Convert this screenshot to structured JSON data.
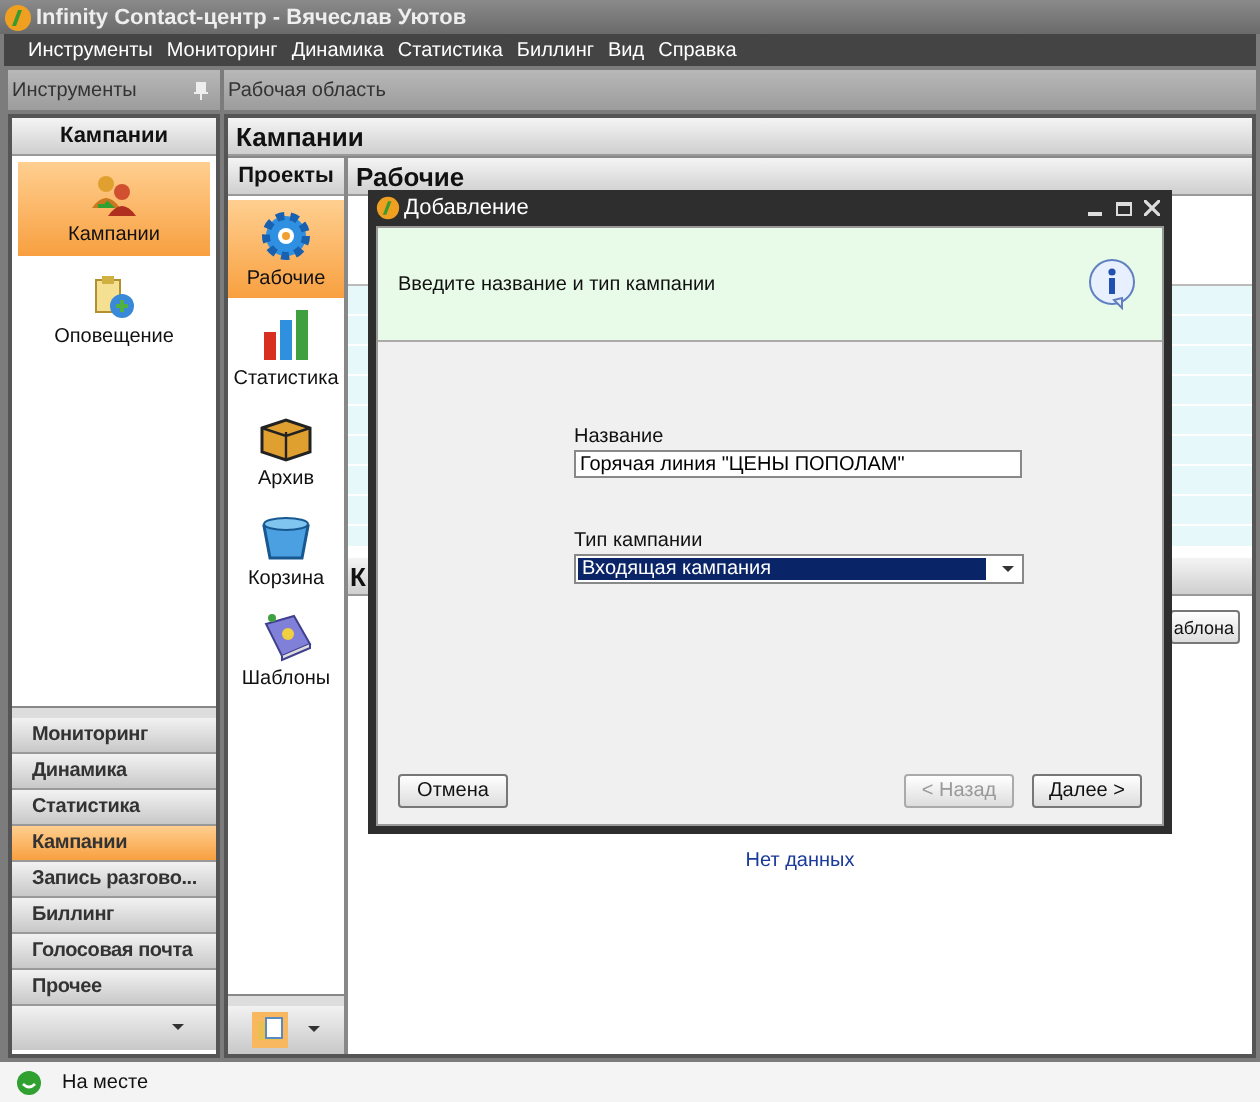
{
  "window": {
    "title": "Infinity Contact-центр - Вячеслав Уютов"
  },
  "menu": [
    "Инструменты",
    "Мониторинг",
    "Динамика",
    "Статистика",
    "Биллинг",
    "Вид",
    "Справка"
  ],
  "tools_panel": {
    "title": "Инструменты",
    "section": "Кампании",
    "items": [
      {
        "label": "Кампании",
        "selected": true
      },
      {
        "label": "Оповещение",
        "selected": false
      }
    ],
    "nav": [
      {
        "label": "Мониторинг",
        "selected": false
      },
      {
        "label": "Динамика",
        "selected": false
      },
      {
        "label": "Статистика",
        "selected": false
      },
      {
        "label": "Кампании",
        "selected": true
      },
      {
        "label": "Запись разгово...",
        "selected": false
      },
      {
        "label": "Биллинг",
        "selected": false
      },
      {
        "label": "Голосовая почта",
        "selected": false
      },
      {
        "label": "Прочее",
        "selected": false
      }
    ]
  },
  "workspace": {
    "title": "Рабочая область",
    "section": "Кампании",
    "projects": {
      "title": "Проекты",
      "items": [
        {
          "label": "Рабочие",
          "selected": true
        },
        {
          "label": "Статистика",
          "selected": false
        },
        {
          "label": "Архив",
          "selected": false
        },
        {
          "label": "Корзина",
          "selected": false
        },
        {
          "label": "Шаблоны",
          "selected": false
        }
      ]
    },
    "content": {
      "title": "Рабочие",
      "section_2": "К",
      "button": "аблона",
      "empty": "Нет данных"
    }
  },
  "dialog": {
    "title": "Добавление",
    "hint": "Введите название и тип кампании",
    "name_label": "Название",
    "name_value": "Горячая линия \"ЦЕНЫ ПОПОЛАМ\"",
    "type_label": "Тип кампании",
    "type_value": "Входящая кампания",
    "buttons": [
      {
        "label": "Отмена",
        "disabled": false
      },
      {
        "label": "< Назад",
        "disabled": true
      },
      {
        "label": "Далее >",
        "disabled": false
      }
    ]
  },
  "status_bar": {
    "text": "На месте"
  }
}
